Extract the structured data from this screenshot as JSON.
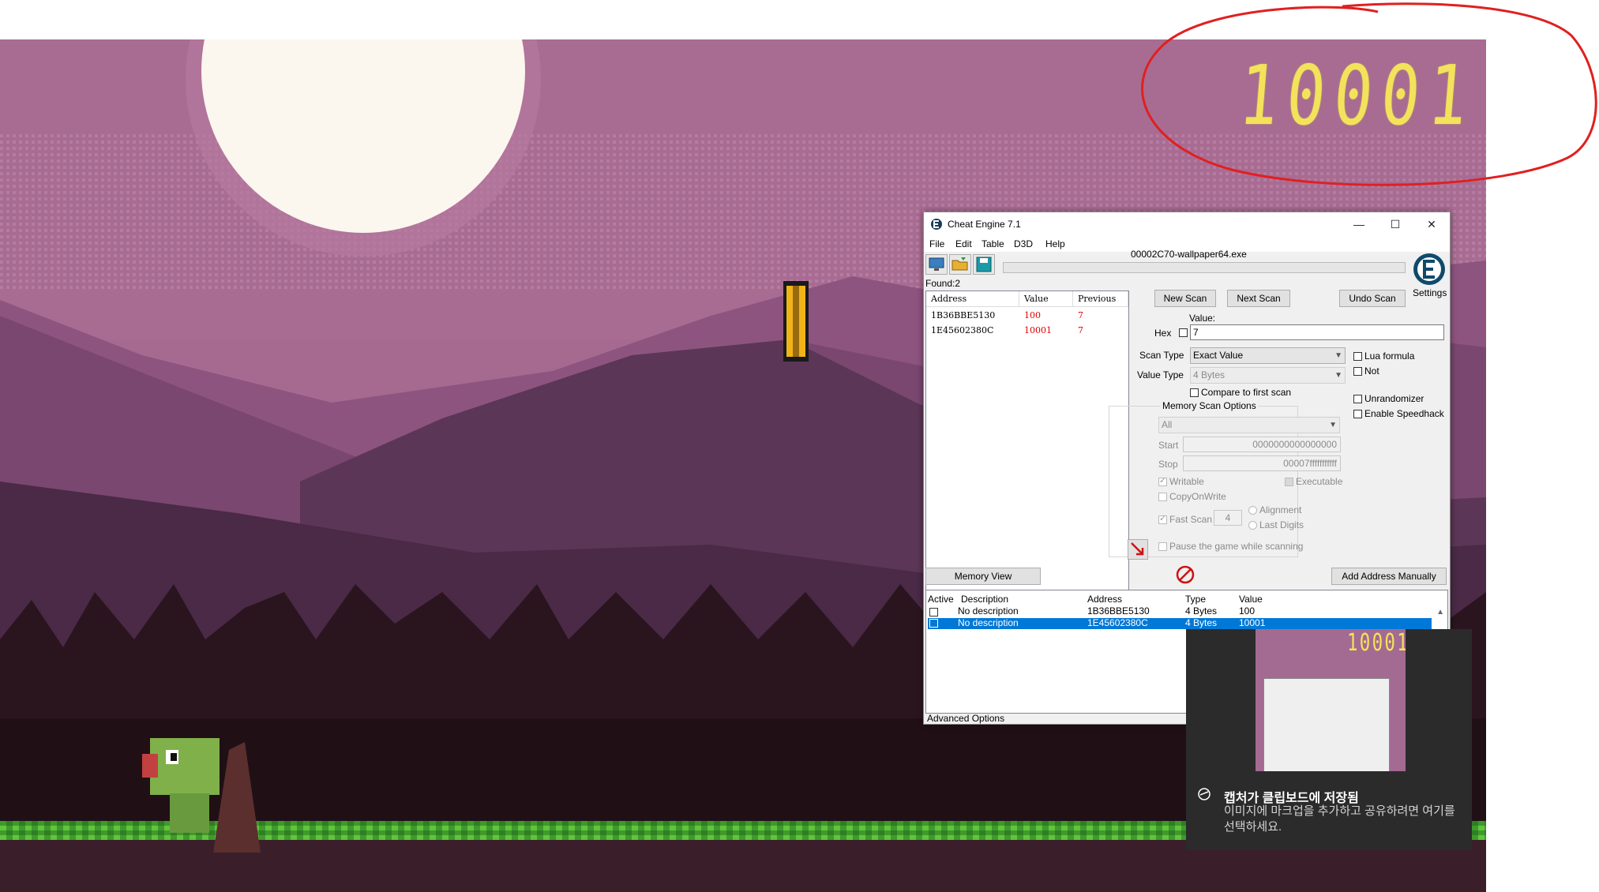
{
  "game": {
    "score": "10001",
    "annotation_color": "#e02020"
  },
  "cheat_engine": {
    "title": "Cheat Engine 7.1",
    "window_controls": {
      "minimize": "—",
      "maximize": "☐",
      "close": "✕"
    },
    "menu": [
      "File",
      "Edit",
      "Table",
      "D3D",
      "Help"
    ],
    "process": "00002C70-wallpaper64.exe",
    "toolbar_icons": [
      "open-process-icon",
      "open-file-icon",
      "save-icon"
    ],
    "found_label": "Found:",
    "found_count": "2",
    "results": {
      "headers": [
        "Address",
        "Value",
        "Previous"
      ],
      "rows": [
        {
          "address": "1B36BBE5130",
          "value": "100",
          "previous": "7"
        },
        {
          "address": "1E45602380C",
          "value": "10001",
          "previous": "7"
        }
      ]
    },
    "buttons": {
      "new_scan": "New Scan",
      "next_scan": "Next Scan",
      "undo_scan": "Undo Scan",
      "settings": "Settings",
      "memory_view": "Memory View",
      "add_address": "Add Address Manually"
    },
    "value_label": "Value:",
    "hex_label": "Hex",
    "value_input": "7",
    "scan_type_label": "Scan Type",
    "scan_type": "Exact Value",
    "value_type_label": "Value Type",
    "value_type": "4 Bytes",
    "compare_first": "Compare to first scan",
    "lua_formula": "Lua formula",
    "not_label": "Not",
    "unrandomizer": "Unrandomizer",
    "speedhack": "Enable Speedhack",
    "memory_scan_options": {
      "title": "Memory Scan Options",
      "region": "All",
      "start_label": "Start",
      "start": "0000000000000000",
      "stop_label": "Stop",
      "stop": "00007fffffffffff",
      "writable": "Writable",
      "executable": "Executable",
      "copy_on_write": "CopyOnWrite",
      "fast_scan": "Fast Scan",
      "fast_scan_value": "4",
      "alignment": "Alignment",
      "last_digits": "Last Digits",
      "pause": "Pause the game while scanning"
    },
    "address_table": {
      "headers": [
        "Active",
        "Description",
        "Address",
        "Type",
        "Value"
      ],
      "rows": [
        {
          "description": "No description",
          "address": "1B36BBE5130",
          "type": "4 Bytes",
          "value": "100"
        },
        {
          "description": "No description",
          "address": "1E45602380C",
          "type": "4 Bytes",
          "value": "10001"
        }
      ]
    },
    "advanced_options": "Advanced Options"
  },
  "toast": {
    "thumb_score": "10001",
    "title": "캡처가 클립보드에 저장됨",
    "message": "이미지에 마크업을 추가하고 공유하려면 여기를 선택하세요."
  }
}
